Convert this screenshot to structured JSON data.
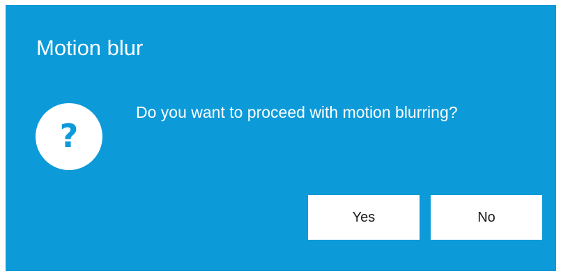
{
  "dialog": {
    "title": "Motion blur",
    "icon": "question-mark-icon",
    "icon_glyph": "?",
    "message": "Do you want to proceed with motion blurring?",
    "buttons": {
      "yes_label": "Yes",
      "no_label": "No"
    },
    "colors": {
      "background": "#0c9ad9",
      "text": "#ffffff",
      "button_background": "#ffffff",
      "button_text": "#1a1a1a"
    }
  }
}
